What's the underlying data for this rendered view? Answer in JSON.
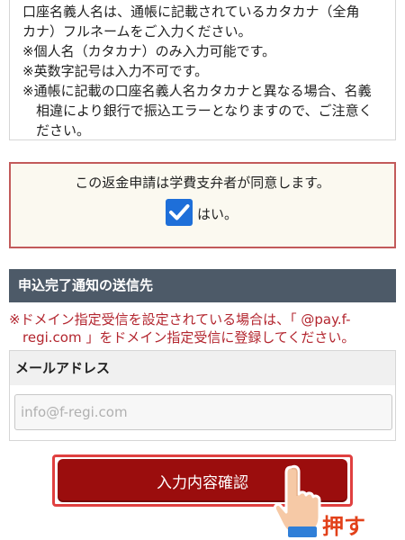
{
  "notes": {
    "lines": [
      "口座名義人名は、通帳に記載されているカタカナ（全角",
      "カナ）フルネームをご入力ください。",
      "※個人名（カタカナ）のみ入力可能です。",
      "※英数字記号は入力不可です。",
      "※通帳に記載の口座名義人名カタカナと異なる場合、名義",
      "　相違により銀行で振込エラーとなりますので、ご注意く",
      "　ださい。"
    ]
  },
  "consent": {
    "text": "この返金申請は学費支弁者が同意します。",
    "checkbox_label": "はい。",
    "checked": true,
    "border_color": "#c25a5a"
  },
  "notification": {
    "header": "申込完了通知の送信先",
    "warning_lines": [
      "※ドメイン指定受信を設定されている場合は、「 @pay.f-",
      "　regi.com 」をドメイン指定受信に登録してください。"
    ],
    "email_label": "メールアドレス",
    "email_placeholder": "info@f-regi.com",
    "email_value": ""
  },
  "actions": {
    "confirm_label": "入力内容確認",
    "press_hint": "押す",
    "button_color": "#9b0d0d",
    "hint_color": "#e2411a"
  }
}
